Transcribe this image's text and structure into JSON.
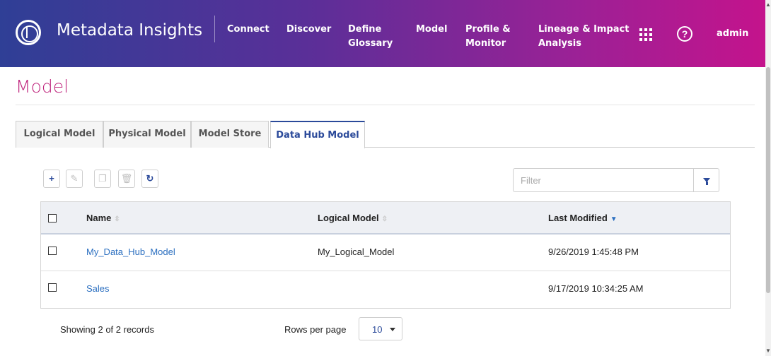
{
  "header": {
    "app_title": "Metadata Insights",
    "nav": [
      {
        "label": "Connect"
      },
      {
        "label": "Discover"
      },
      {
        "label": "Define\nGlossary"
      },
      {
        "label": "Model"
      },
      {
        "label": "Profile &\nMonitor"
      },
      {
        "label": "Lineage & Impact\nAnalysis"
      }
    ],
    "help_glyph": "?",
    "user": "admin",
    "icons": [
      "app-logo-icon",
      "apps-grid-icon",
      "help-icon"
    ]
  },
  "page": {
    "title": "Model"
  },
  "tabs": [
    {
      "label": "Logical Model",
      "active": false
    },
    {
      "label": "Physical Model",
      "active": false
    },
    {
      "label": "Model Store",
      "active": false
    },
    {
      "label": "Data Hub Model",
      "active": true
    }
  ],
  "toolbar": {
    "buttons": [
      {
        "name": "add-icon",
        "glyph": "+",
        "enabled": true
      },
      {
        "name": "edit-icon",
        "glyph": "✎",
        "enabled": false
      },
      {
        "name": "copy-icon",
        "glyph": "❐",
        "enabled": false
      },
      {
        "name": "delete-icon",
        "glyph": "🗑",
        "enabled": false
      },
      {
        "name": "refresh-icon",
        "glyph": "↻",
        "enabled": true
      }
    ],
    "filter_placeholder": "Filter"
  },
  "table": {
    "columns": [
      {
        "label": "Name",
        "sort": "none"
      },
      {
        "label": "Logical Model",
        "sort": "none"
      },
      {
        "label": "Last Modified",
        "sort": "desc"
      }
    ],
    "sort_glyph": "⇳",
    "sort_active_glyph": "▼",
    "rows": [
      {
        "name": "My_Data_Hub_Model",
        "logical_model": "My_Logical_Model",
        "last_modified": "9/26/2019 1:45:48 PM"
      },
      {
        "name": "Sales",
        "logical_model": "",
        "last_modified": "9/17/2019 10:34:25 AM"
      }
    ]
  },
  "footer": {
    "showing": "Showing 2 of 2 records",
    "rows_per_page_label": "Rows per page",
    "rows_per_page_value": "10"
  },
  "colors": {
    "accent": "#2b4a9a",
    "link": "#2b6fc0",
    "title": "#c0287f",
    "header_gradient_start": "#2f3f96",
    "header_gradient_end": "#c4138c"
  }
}
